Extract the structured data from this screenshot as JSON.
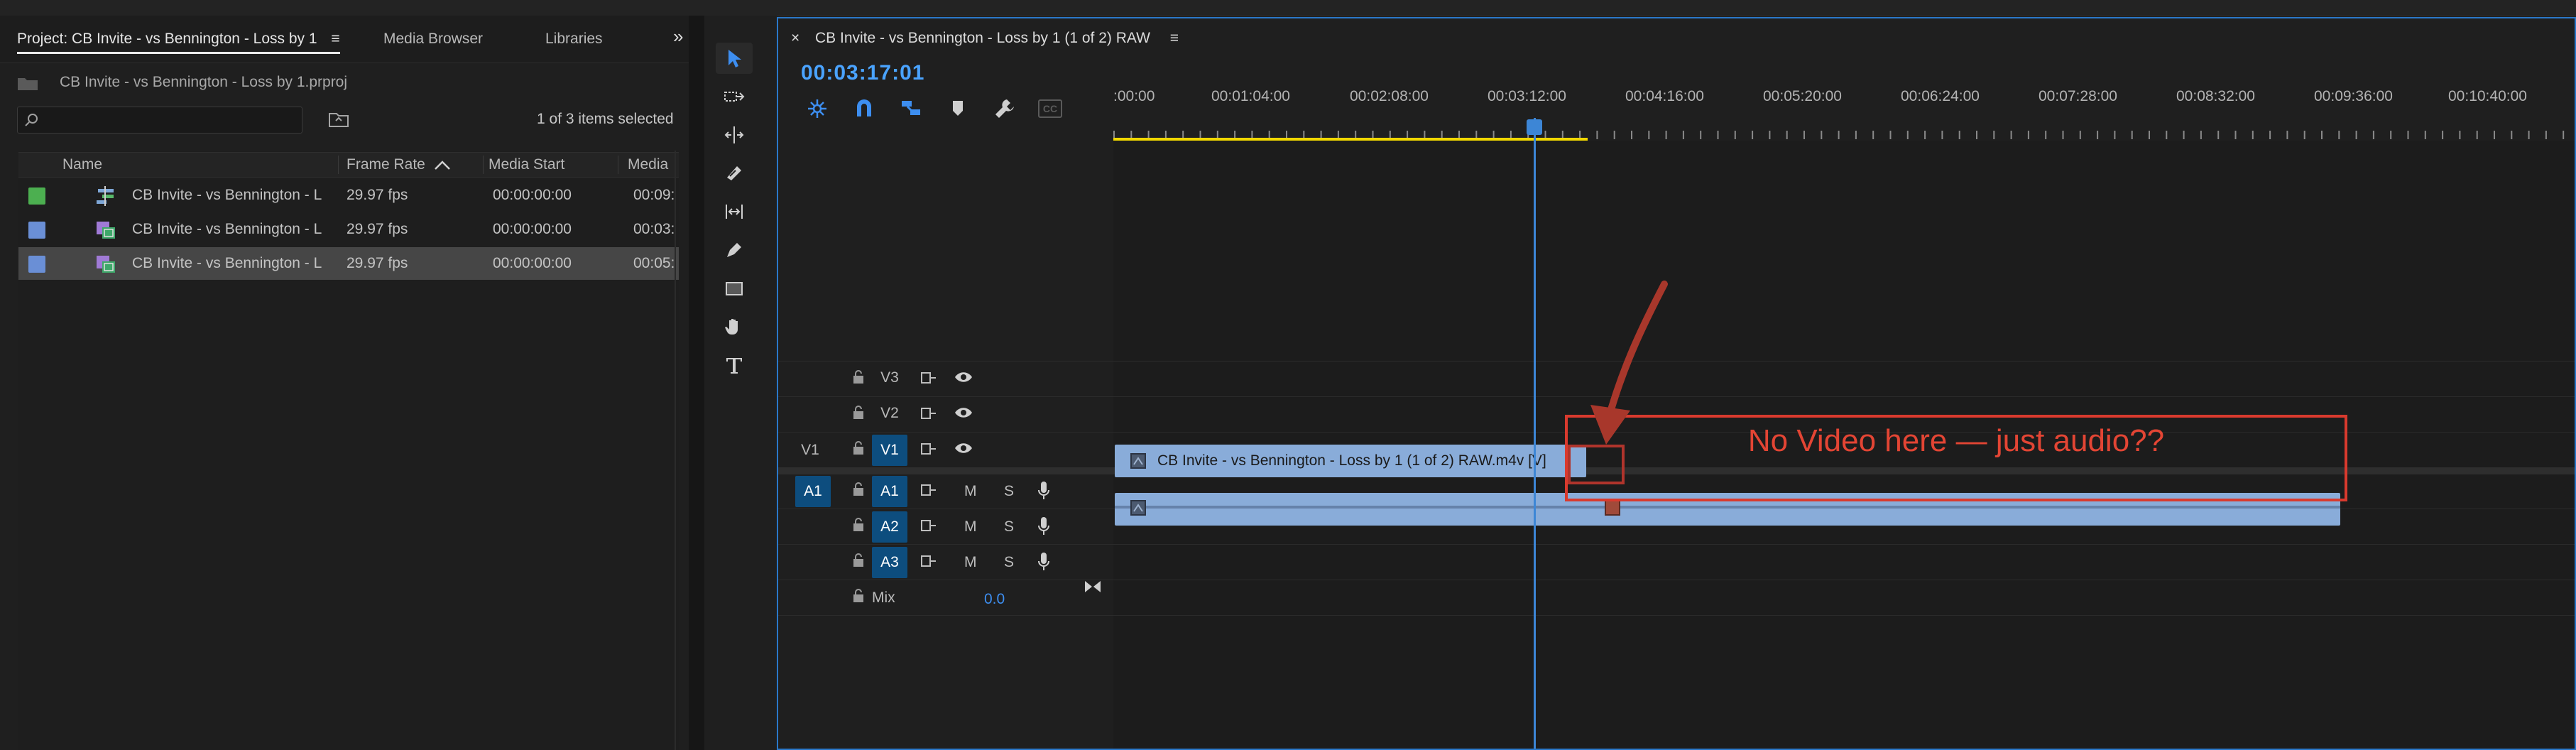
{
  "project_panel": {
    "tabs": [
      "Project: CB Invite - vs Bennington - Loss by 1",
      "Media Browser",
      "Libraries"
    ],
    "overflow_glyph": "»",
    "menu_glyph": "≡",
    "project_file": "CB Invite - vs Bennington - Loss by 1.prproj",
    "search_placeholder": "",
    "items_selected": "1 of 3 items selected",
    "columns": [
      "Name",
      "Frame Rate",
      "Media Start",
      "Media"
    ],
    "rows": [
      {
        "color": "#4caf50",
        "icon": "sequence-icon",
        "name": "CB Invite - vs Bennington - L",
        "rate": "29.97 fps",
        "start": "00:00:00:00",
        "media": "00:09:",
        "selected": false
      },
      {
        "color": "#6a8fd6",
        "icon": "clip-icon",
        "name": "CB Invite - vs Bennington - L",
        "rate": "29.97 fps",
        "start": "00:00:00:00",
        "media": "00:03:",
        "selected": false
      },
      {
        "color": "#6a8fd6",
        "icon": "clip-icon",
        "name": "CB Invite - vs Bennington - L",
        "rate": "29.97 fps",
        "start": "00:00:00:00",
        "media": "00:05:",
        "selected": true
      }
    ]
  },
  "tools": [
    "selection-tool-icon",
    "track-select-icon",
    "ripple-edit-icon",
    "razor-icon",
    "slip-icon",
    "pen-icon",
    "rectangle-icon",
    "hand-icon",
    "type-icon"
  ],
  "timeline": {
    "close_glyph": "×",
    "menu_glyph": "≡",
    "title": "CB Invite - vs Bennington - Loss by 1 (1 of 2) RAW",
    "timecode": "00:03:17:01",
    "ruler": [
      ":00:00",
      "00:01:04:00",
      "00:02:08:00",
      "00:03:12:00",
      "00:04:16:00",
      "00:05:20:00",
      "00:06:24:00",
      "00:07:28:00",
      "00:08:32:00",
      "00:09:36:00",
      "00:10:40:00"
    ],
    "cc_label": "CC",
    "video_tracks": [
      "V3",
      "V2",
      "V1"
    ],
    "audio_tracks": [
      "A1",
      "A2",
      "A3"
    ],
    "source_v": "V1",
    "source_a": "A1",
    "m_label": "M",
    "s_label": "S",
    "mix_label": "Mix",
    "mix_value": "0.0",
    "video_clip": "CB Invite - vs Bennington - Loss by 1 (1 of 2) RAW.m4v [V]",
    "annotation": "No Video here — just audio??"
  },
  "colors": {
    "accent": "#2a78c9",
    "clip": "#89acd9",
    "annotation": "#d93a2e",
    "timecode": "#4aa3ff"
  }
}
